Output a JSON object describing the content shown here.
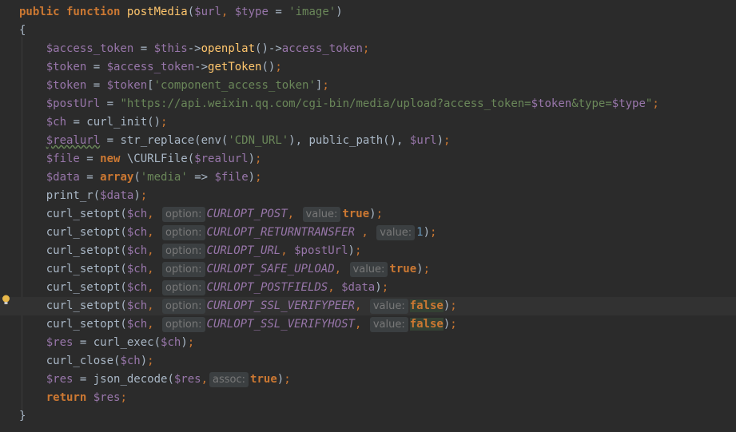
{
  "editor": {
    "lines": [
      {
        "id": "sig",
        "parts": [
          [
            "kw",
            "public function "
          ],
          [
            "fn",
            "postMedia"
          ],
          [
            "plain",
            "("
          ],
          [
            "var",
            "$url"
          ],
          [
            "punc",
            ", "
          ],
          [
            "var",
            "$type"
          ],
          [
            "plain",
            " = "
          ],
          [
            "str",
            "'image'"
          ],
          [
            "plain",
            ")"
          ]
        ]
      },
      {
        "id": "open-brace",
        "parts": [
          [
            "plain",
            "{"
          ]
        ]
      },
      {
        "id": "l3",
        "parts": [
          [
            "var",
            "    $access_token"
          ],
          [
            "plain",
            " = "
          ],
          [
            "var",
            "$this"
          ],
          [
            "plain",
            "->"
          ],
          [
            "fn",
            "openplat"
          ],
          [
            "plain",
            "()->"
          ],
          [
            "var",
            "access_token"
          ],
          [
            "punc",
            ";"
          ]
        ]
      },
      {
        "id": "l4",
        "parts": [
          [
            "var",
            "    $token"
          ],
          [
            "plain",
            " = "
          ],
          [
            "var",
            "$access_token"
          ],
          [
            "plain",
            "->"
          ],
          [
            "fn",
            "getToken"
          ],
          [
            "plain",
            "()"
          ],
          [
            "punc",
            ";"
          ]
        ]
      },
      {
        "id": "l5",
        "parts": [
          [
            "var",
            "    $token"
          ],
          [
            "plain",
            " = "
          ],
          [
            "var",
            "$token"
          ],
          [
            "plain",
            "["
          ],
          [
            "str",
            "'component_access_token'"
          ],
          [
            "plain",
            "]"
          ],
          [
            "punc",
            ";"
          ]
        ]
      },
      {
        "id": "l6",
        "parts": [
          [
            "var",
            "    $postUrl"
          ],
          [
            "plain",
            " = "
          ],
          [
            "str",
            "\"https://api.weixin.qq.com/cgi-bin/media/upload?access_token="
          ],
          [
            "var",
            "$token"
          ],
          [
            "str",
            "&type="
          ],
          [
            "var",
            "$type"
          ],
          [
            "str",
            "\""
          ],
          [
            "punc",
            ";"
          ]
        ]
      },
      {
        "id": "l7",
        "parts": [
          [
            "var",
            "    $ch"
          ],
          [
            "plain",
            " = curl_init()"
          ],
          [
            "punc",
            ";"
          ]
        ]
      },
      {
        "id": "l8",
        "parts": [
          [
            "var",
            "    "
          ],
          [
            "var wavy",
            "$realurl"
          ],
          [
            "plain",
            " = str_replace(env("
          ],
          [
            "str",
            "'CDN_URL'"
          ],
          [
            "plain",
            "), public_path(), "
          ],
          [
            "var",
            "$url"
          ],
          [
            "plain",
            ")"
          ],
          [
            "punc",
            ";"
          ]
        ]
      },
      {
        "id": "l9",
        "parts": [
          [
            "var",
            "    $file"
          ],
          [
            "plain",
            " = "
          ],
          [
            "kw",
            "new "
          ],
          [
            "plain",
            "\\CURLFile("
          ],
          [
            "var",
            "$realurl"
          ],
          [
            "plain",
            ")"
          ],
          [
            "punc",
            ";"
          ]
        ]
      },
      {
        "id": "l10",
        "parts": [
          [
            "var",
            "    $data"
          ],
          [
            "plain",
            " = "
          ],
          [
            "kw",
            "array"
          ],
          [
            "plain",
            "("
          ],
          [
            "str",
            "'media'"
          ],
          [
            "plain",
            " => "
          ],
          [
            "var",
            "$file"
          ],
          [
            "plain",
            ")"
          ],
          [
            "punc",
            ";"
          ]
        ]
      },
      {
        "id": "l11",
        "parts": [
          [
            "plain",
            "    print_r("
          ],
          [
            "var",
            "$data"
          ],
          [
            "plain",
            ")"
          ],
          [
            "punc",
            ";"
          ]
        ]
      },
      {
        "id": "l12",
        "parts": [
          [
            "plain",
            "    curl_setopt("
          ],
          [
            "var",
            "$ch"
          ],
          [
            "punc",
            ", "
          ],
          [
            "hint",
            "option:"
          ],
          [
            "cst",
            "CURLOPT_POST"
          ],
          [
            "punc",
            ", "
          ],
          [
            "hint",
            "value:"
          ],
          [
            "kw",
            "true"
          ],
          [
            "plain",
            ")"
          ],
          [
            "punc",
            ";"
          ]
        ]
      },
      {
        "id": "l13",
        "parts": [
          [
            "plain",
            "    curl_setopt("
          ],
          [
            "var",
            "$ch"
          ],
          [
            "punc",
            ", "
          ],
          [
            "hint",
            "option:"
          ],
          [
            "cst",
            "CURLOPT_RETURNTRANSFER"
          ],
          [
            "punc",
            " , "
          ],
          [
            "hint",
            "value:"
          ],
          [
            "num",
            "1"
          ],
          [
            "plain",
            ")"
          ],
          [
            "punc",
            ";"
          ]
        ]
      },
      {
        "id": "l14",
        "parts": [
          [
            "plain",
            "    curl_setopt("
          ],
          [
            "var",
            "$ch"
          ],
          [
            "punc",
            ", "
          ],
          [
            "hint",
            "option:"
          ],
          [
            "cst",
            "CURLOPT_URL"
          ],
          [
            "punc",
            ", "
          ],
          [
            "var",
            "$postUrl"
          ],
          [
            "plain",
            ")"
          ],
          [
            "punc",
            ";"
          ]
        ]
      },
      {
        "id": "l15",
        "parts": [
          [
            "plain",
            "    curl_setopt("
          ],
          [
            "var",
            "$ch"
          ],
          [
            "punc",
            ", "
          ],
          [
            "hint",
            "option:"
          ],
          [
            "cst",
            "CURLOPT_SAFE_UPLOAD"
          ],
          [
            "punc",
            ", "
          ],
          [
            "hint",
            "value:"
          ],
          [
            "kw",
            "true"
          ],
          [
            "plain",
            ")"
          ],
          [
            "punc",
            ";"
          ]
        ]
      },
      {
        "id": "l16",
        "parts": [
          [
            "plain",
            "    curl_setopt("
          ],
          [
            "var",
            "$ch"
          ],
          [
            "punc",
            ", "
          ],
          [
            "hint",
            "option:"
          ],
          [
            "cst",
            "CURLOPT_POSTFIELDS"
          ],
          [
            "punc",
            ", "
          ],
          [
            "var",
            "$data"
          ],
          [
            "plain",
            ")"
          ],
          [
            "punc",
            ";"
          ]
        ]
      },
      {
        "id": "l17",
        "current": true,
        "parts": [
          [
            "plain",
            "    curl_setopt("
          ],
          [
            "var",
            "$ch"
          ],
          [
            "punc",
            ", "
          ],
          [
            "hint",
            "option:"
          ],
          [
            "cst",
            "CURLOPT_SSL_VERIFYPEER"
          ],
          [
            "punc",
            ", "
          ],
          [
            "hint",
            "value:"
          ],
          [
            "kw hl",
            "false"
          ],
          [
            "plain",
            ")"
          ],
          [
            "punc",
            ";"
          ]
        ]
      },
      {
        "id": "l18",
        "parts": [
          [
            "plain",
            "    curl_setopt("
          ],
          [
            "var",
            "$ch"
          ],
          [
            "punc",
            ", "
          ],
          [
            "hint",
            "option:"
          ],
          [
            "cst",
            "CURLOPT_SSL_VERIFYHOST"
          ],
          [
            "punc",
            ", "
          ],
          [
            "hint",
            "value:"
          ],
          [
            "kw hl",
            "false"
          ],
          [
            "plain",
            ")"
          ],
          [
            "punc",
            ";"
          ]
        ]
      },
      {
        "id": "l19",
        "parts": [
          [
            "var",
            "    $res"
          ],
          [
            "plain",
            " = curl_exec("
          ],
          [
            "var",
            "$ch"
          ],
          [
            "plain",
            ")"
          ],
          [
            "punc",
            ";"
          ]
        ]
      },
      {
        "id": "l20",
        "parts": [
          [
            "plain",
            "    curl_close("
          ],
          [
            "var",
            "$ch"
          ],
          [
            "plain",
            ")"
          ],
          [
            "punc",
            ";"
          ]
        ]
      },
      {
        "id": "l21",
        "parts": [
          [
            "var",
            "    $res"
          ],
          [
            "plain",
            " = json_decode("
          ],
          [
            "var",
            "$res"
          ],
          [
            "punc",
            ","
          ],
          [
            "hint",
            "assoc:"
          ],
          [
            "kw",
            "true"
          ],
          [
            "plain",
            ")"
          ],
          [
            "punc",
            ";"
          ]
        ]
      },
      {
        "id": "l22",
        "parts": [
          [
            "kw",
            "    return "
          ],
          [
            "var",
            "$res"
          ],
          [
            "punc",
            ";"
          ]
        ]
      },
      {
        "id": "close-brace",
        "parts": [
          [
            "plain",
            "}"
          ]
        ]
      }
    ],
    "bulb_icon": "lightbulb-icon"
  }
}
